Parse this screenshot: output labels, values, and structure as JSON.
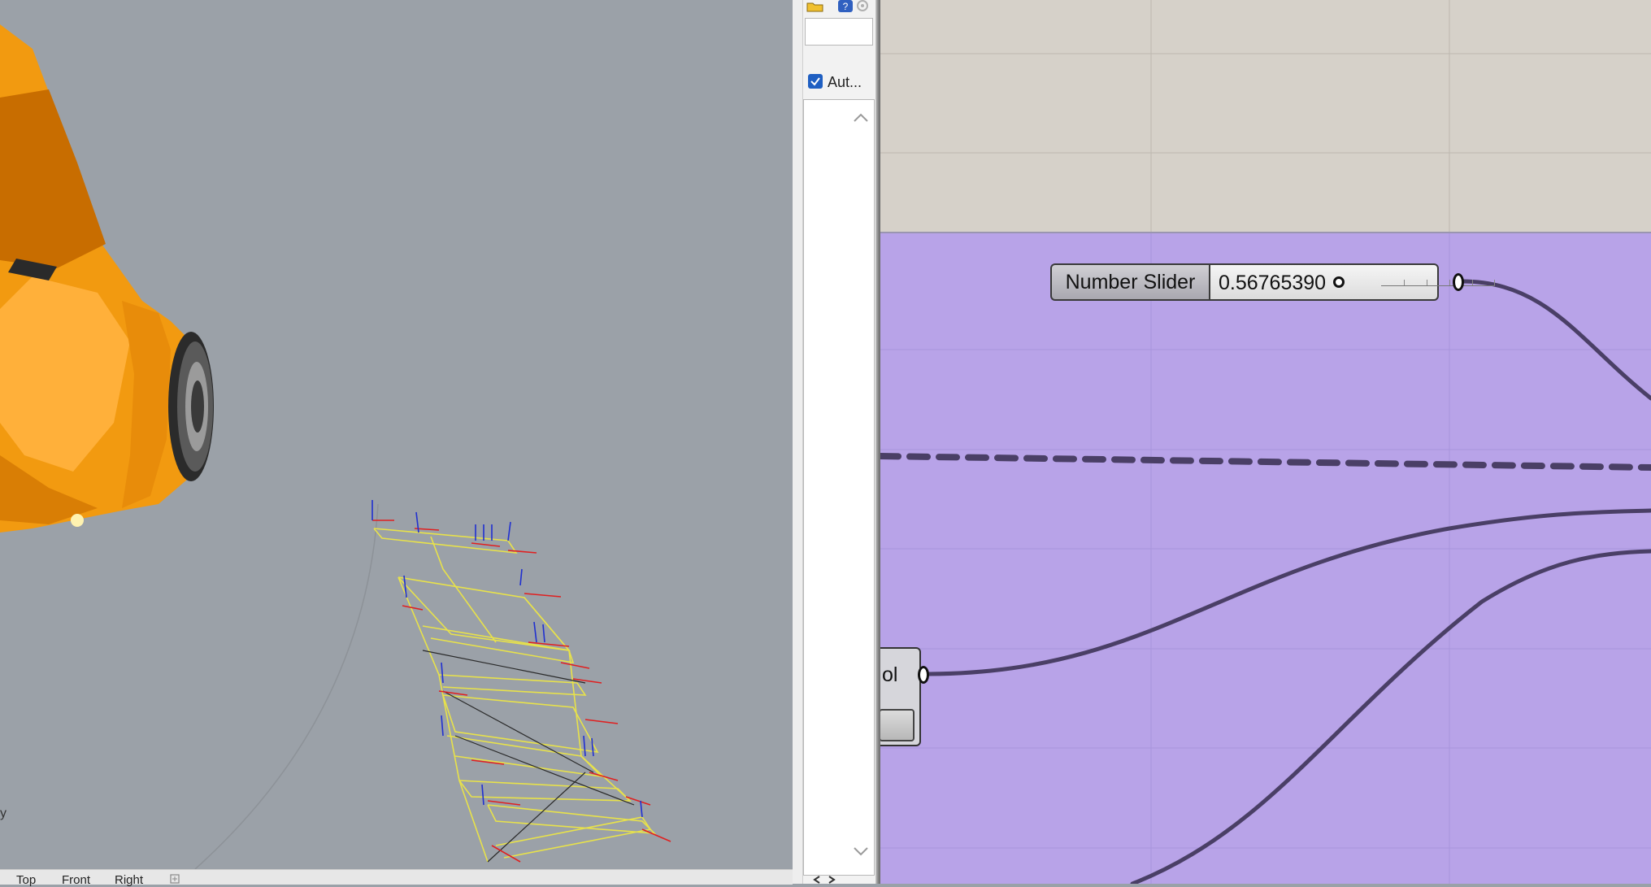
{
  "viewport": {
    "tabs": [
      "Top",
      "Front",
      "Right"
    ],
    "add_tab_icon": "plus-icon",
    "corner_label": "y",
    "colors": {
      "background": "#9ba1a8",
      "robot": "#f29a10",
      "path": "#e8e24a",
      "axis_x": "#e02020",
      "axis_y": "#2030d0"
    }
  },
  "side_panel": {
    "toolbar_icons": [
      "folder-icon",
      "help-icon",
      "settings-icon"
    ],
    "search_placeholder": "",
    "auto_checkbox": {
      "label": "Aut...",
      "checked": true
    },
    "scroll_up_icon": "chevron-up-icon",
    "scroll_down_icon": "chevron-down-icon",
    "nav_icons": [
      "chevron-left-icon",
      "chevron-right-icon"
    ]
  },
  "canvas": {
    "colors": {
      "group_fill": "#b8a3e8",
      "background": "#d6d1c9",
      "wire": "#4a3f66"
    },
    "number_slider": {
      "name": "Number Slider",
      "value": "0.56765390",
      "fraction": 0.36
    },
    "tool_component": {
      "label_fragment": "ol"
    }
  }
}
